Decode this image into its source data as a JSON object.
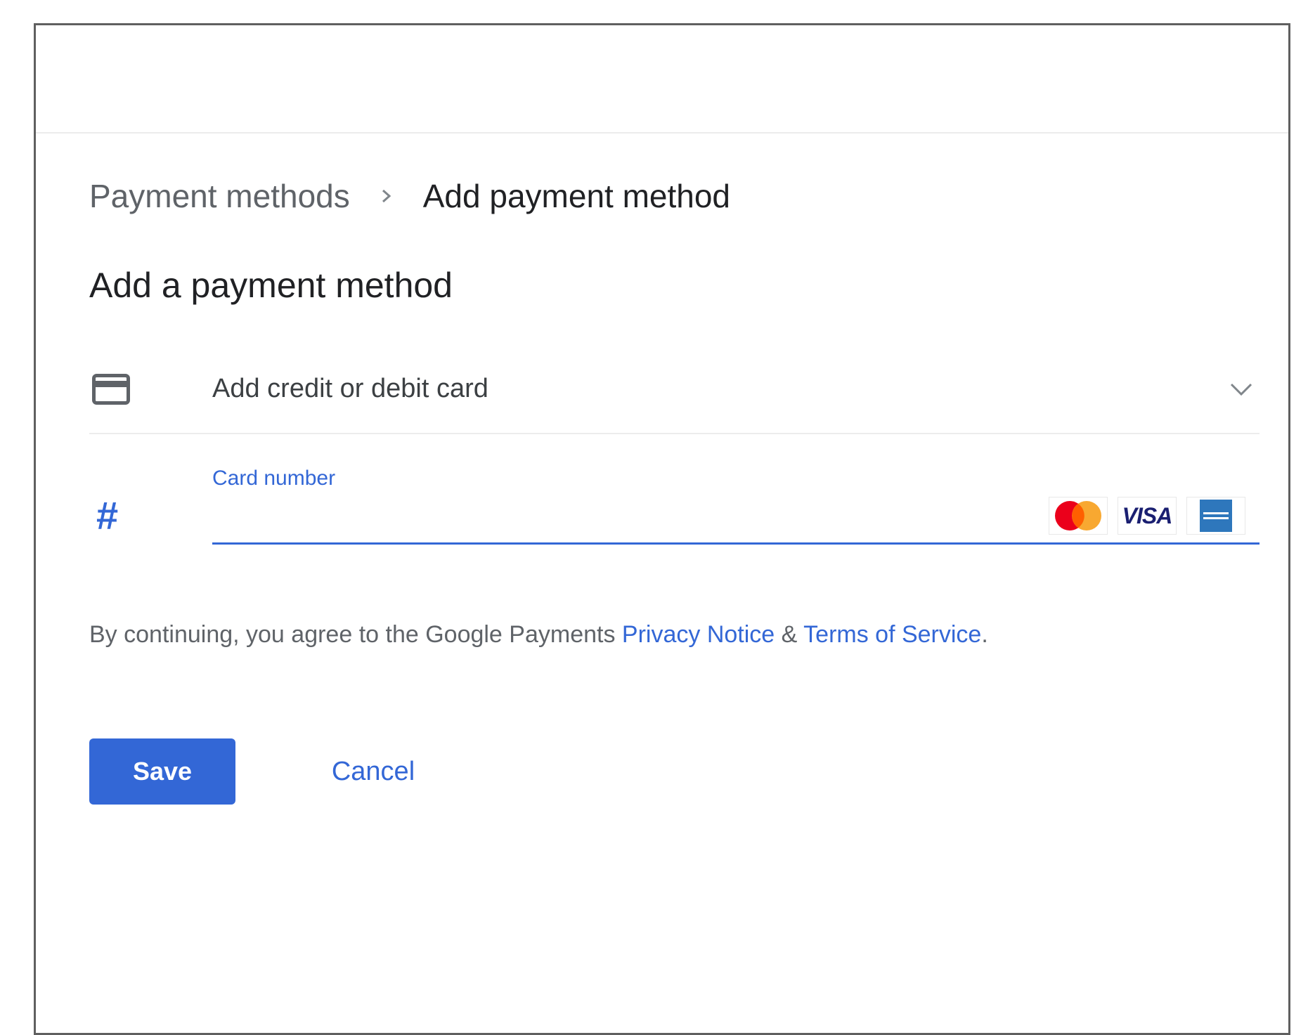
{
  "breadcrumb": {
    "parent": "Payment methods",
    "separator_icon": "chevron-right-icon",
    "current": "Add payment method"
  },
  "section": {
    "title": "Add a payment method"
  },
  "card_option": {
    "icon": "credit-card-icon",
    "label": "Add credit or debit card",
    "expand_icon": "chevron-down-icon"
  },
  "card_number": {
    "icon": "#",
    "label": "Card number",
    "value": "",
    "accepted_brands": [
      "mastercard-logo",
      "visa-logo",
      "amex-logo"
    ],
    "visa_text": "VISA"
  },
  "legal": {
    "prefix": "By continuing, you agree to the Google Payments ",
    "privacy_link": "Privacy Notice",
    "joiner": " & ",
    "terms_link": "Terms of Service",
    "suffix": "."
  },
  "actions": {
    "save_label": "Save",
    "cancel_label": "Cancel"
  },
  "colors": {
    "accent": "#3367d6",
    "text_primary": "#202124",
    "text_secondary": "#5f6368",
    "divider": "#ececec"
  }
}
